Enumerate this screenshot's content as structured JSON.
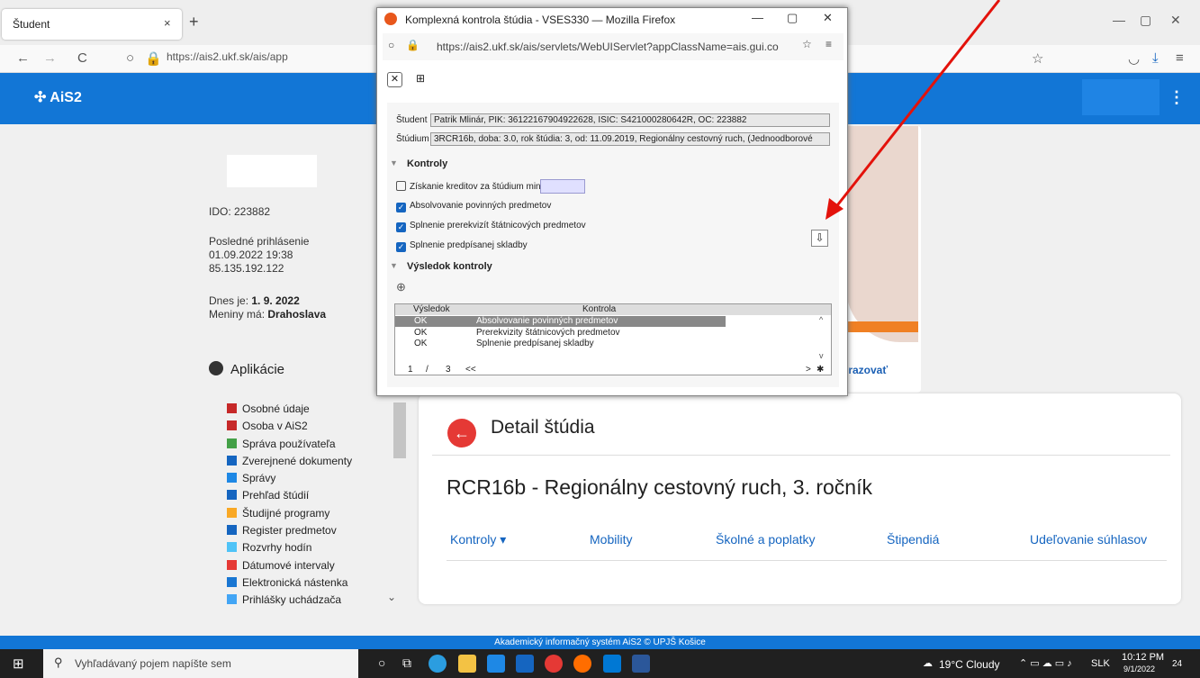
{
  "browser": {
    "tab_title": "Študent",
    "tab_close": "×",
    "new_tab": "+",
    "url": "https://ais2.ukf.sk/ais/app",
    "win_min": "—",
    "win_max": "▢",
    "win_close": "✕"
  },
  "app": {
    "logo": "AiS2",
    "menu": "⋮",
    "footer": "Akademický informačný systém AiS2 © UPJŠ Košice"
  },
  "left_panel": {
    "ido": "IDO: 223882",
    "last_login_label": "Posledné prihlásenie",
    "last_login_date": "01.09.2022 19:38",
    "last_login_ip": "85.135.192.122",
    "today_label": "Dnes je: ",
    "today_value": "1. 9. 2022",
    "nameday_label": "Meniny má: ",
    "nameday_value": "Drahoslava",
    "apps_heading": "Aplikácie",
    "items": [
      {
        "label": "Osobné údaje",
        "color": "#c62828"
      },
      {
        "label": "Osoba v AiS2",
        "color": "#c62828"
      },
      {
        "label": "Správa používateľa",
        "color": "#43a047"
      },
      {
        "label": "Zverejnené dokumenty",
        "color": "#1565c0"
      },
      {
        "label": "Správy",
        "color": "#1e88e5"
      },
      {
        "label": "Prehľad štúdií",
        "color": "#1565c0"
      },
      {
        "label": "Študijné programy",
        "color": "#f9a825"
      },
      {
        "label": "Register predmetov",
        "color": "#1565c0"
      },
      {
        "label": "Rozvrhy hodín",
        "color": "#4fc3f7"
      },
      {
        "label": "Dátumové intervaly",
        "color": "#e53935"
      },
      {
        "label": "Elektronická nástenka",
        "color": "#1976d2"
      },
      {
        "label": "Prihlášky uchádzača",
        "color": "#42a5f5"
      }
    ]
  },
  "banner": {
    "link": "brazovať"
  },
  "detail": {
    "back": "←",
    "title": "Detail štúdia",
    "study": "RCR16b - Regionálny cestovný ruch, 3. ročník",
    "tabs": [
      "Kontroly ▾",
      "Mobility",
      "Školné a poplatky",
      "Štipendiá",
      "Udeľovanie súhlasov"
    ]
  },
  "popup": {
    "window_title": "Komplexná kontrola štúdia - VSES330 — Mozilla Firefox",
    "url": "https://ais2.ukf.sk/ais/servlets/WebUIServlet?appClassName=ais.gui.co",
    "student_label": "Študent",
    "student_value": "Patrik Mlinár, PIK: 36122167904922628, ISIC: S421000280642R, OC: 223882",
    "study_label": "Štúdium",
    "study_value": "3RCR16b, doba: 3.0, rok štúdia: 3, od: 11.09.2019, Regionálny cestovný ruch, (Jednoodborové",
    "kontroly_heading": "Kontroly",
    "checks": [
      {
        "label": "Získanie kreditov za štúdium min.",
        "checked": false
      },
      {
        "label": "Absolvovanie povinných predmetov",
        "checked": true
      },
      {
        "label": "Splnenie prerekvizít štátnicových predmetov",
        "checked": true
      },
      {
        "label": "Splnenie predpísanej skladby",
        "checked": true
      }
    ],
    "result_heading": "Výsledok kontroly",
    "table_headers": [
      "Výsledok",
      "Kontrola"
    ],
    "table_rows": [
      {
        "result": "OK",
        "check": "Absolvovanie povinných predmetov"
      },
      {
        "result": "OK",
        "check": "Prerekvizity štátnicových predmetov"
      },
      {
        "result": "OK",
        "check": "Splnenie predpísanej skladby"
      }
    ],
    "pager_page": "1",
    "pager_sep": "/",
    "pager_total": "3",
    "pager_prev": "<<",
    "pager_next": ">"
  },
  "taskbar": {
    "search_placeholder": "Vyhľadávaný pojem napíšte sem",
    "weather": "19°C  Cloudy",
    "lang": "SLK",
    "time": "10:12 PM",
    "date": "9/1/2022",
    "notif": "24"
  },
  "colors": {
    "brand_blue": "#1276d6",
    "accent_red": "#e53935",
    "annotation_arrow": "#e3120b"
  }
}
